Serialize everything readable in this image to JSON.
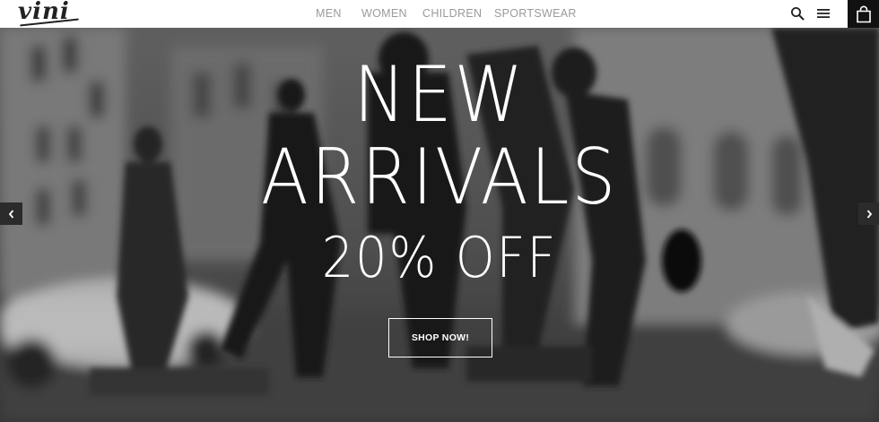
{
  "header": {
    "logo_text": "vini",
    "nav": [
      {
        "label": "MEN"
      },
      {
        "label": "WOMEN"
      },
      {
        "label": "CHILDREN"
      },
      {
        "label": "SPORTSWEAR"
      }
    ],
    "icons": [
      "search-icon",
      "menu-icon",
      "shopping-bag-icon"
    ]
  },
  "hero": {
    "line1": "NEW",
    "line2": "ARRIVALS",
    "line3": "20% OFF",
    "cta_label": "SHOP NOW!",
    "prev_icon": "chevron-left-icon",
    "next_icon": "chevron-right-icon"
  },
  "colors": {
    "header_bg": "#ffffff",
    "nav_text": "#9a9a9a",
    "cart_bg": "#111111",
    "hero_text": "#ffffff"
  }
}
